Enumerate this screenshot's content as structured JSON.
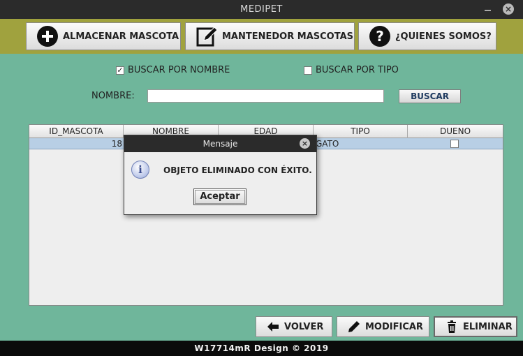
{
  "window": {
    "title": "MEDIPET"
  },
  "nav": {
    "store_label": "ALMACENAR MASCOTA",
    "maintain_label": "MANTENEDOR MASCOTAS",
    "about_label": "¿QUIENES SOMOS?"
  },
  "search": {
    "by_name_label": "BUSCAR POR NOMBRE",
    "by_name_checked": true,
    "by_type_label": "BUSCAR POR TIPO",
    "by_type_checked": false,
    "name_label": "NOMBRE:",
    "name_value": "",
    "button_label": "BUSCAR"
  },
  "table": {
    "columns": [
      "ID_MASCOTA",
      "NOMBRE",
      "EDAD",
      "TIPO",
      "DUENO"
    ],
    "rows": [
      {
        "id": "18",
        "tipo": "GATO",
        "dueno_checked": false
      }
    ]
  },
  "actions": {
    "back_label": "VOLVER",
    "modify_label": "MODIFICAR",
    "delete_label": "ELIMINAR"
  },
  "footer": {
    "text": "W17714mR Design © 2019"
  },
  "dialog": {
    "title": "Mensaje",
    "message": "OBJETO ELIMINADO CON ÉXITO.",
    "button_label": "Aceptar"
  },
  "colors": {
    "main_bg": "#6fb69b",
    "topbar_bg": "#a0a23e",
    "selection": "#b8cfe5"
  }
}
